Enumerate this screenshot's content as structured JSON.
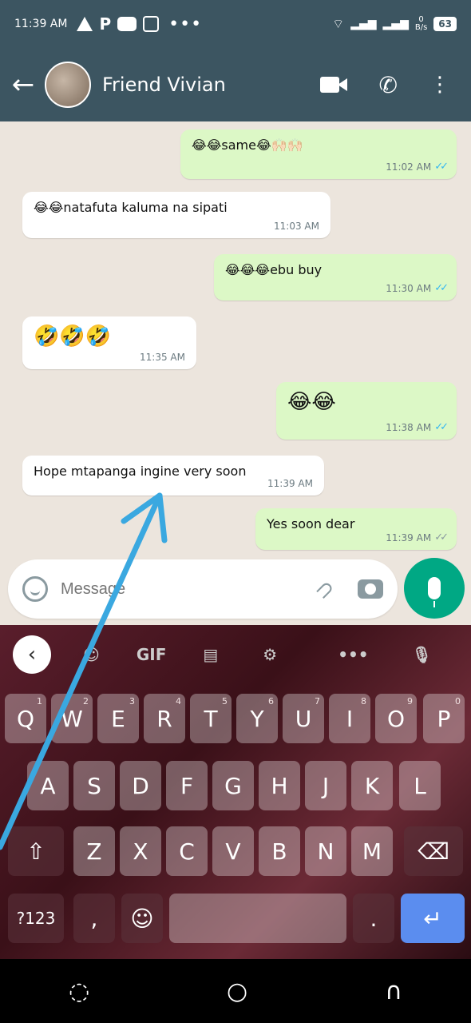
{
  "statusbar": {
    "time": "11:39 AM",
    "battery": "63",
    "speed_top": "0",
    "speed_unit": "B/s"
  },
  "header": {
    "contact_name": "Friend Vivian"
  },
  "messages": [
    {
      "dir": "out",
      "text": "😂😂same😂🙌🏻🙌🏻",
      "time": "11:02 AM",
      "status": "read"
    },
    {
      "dir": "in",
      "text": "😂😂natafuta kaluma na sipati",
      "time": "11:03 AM"
    },
    {
      "dir": "out",
      "text": "😂😂😂ebu buy",
      "time": "11:30 AM",
      "status": "read"
    },
    {
      "dir": "in",
      "text": "🤣🤣🤣",
      "time": "11:35 AM"
    },
    {
      "dir": "out",
      "text": "😂😂",
      "time": "11:38 AM",
      "status": "read"
    },
    {
      "dir": "in",
      "text": "Hope mtapanga ingine very soon",
      "time": "11:39 AM"
    },
    {
      "dir": "out",
      "text": "Yes soon dear",
      "time": "11:39 AM",
      "status": "delivered"
    }
  ],
  "input": {
    "placeholder": "Message"
  },
  "keyboard": {
    "toolbar": {
      "gif": "GIF",
      "more": "•••"
    },
    "row1": [
      {
        "k": "Q",
        "h": "1"
      },
      {
        "k": "W",
        "h": "2"
      },
      {
        "k": "E",
        "h": "3"
      },
      {
        "k": "R",
        "h": "4"
      },
      {
        "k": "T",
        "h": "5"
      },
      {
        "k": "Y",
        "h": "6"
      },
      {
        "k": "U",
        "h": "7"
      },
      {
        "k": "I",
        "h": "8"
      },
      {
        "k": "O",
        "h": "9"
      },
      {
        "k": "P",
        "h": "0"
      }
    ],
    "row2": [
      "A",
      "S",
      "D",
      "F",
      "G",
      "H",
      "J",
      "K",
      "L"
    ],
    "row3": [
      "Z",
      "X",
      "C",
      "V",
      "B",
      "N",
      "M"
    ],
    "sym": "?123",
    "comma": ",",
    "period": "."
  },
  "colors": {
    "header": "#3c5561",
    "outgoing": "#dcf8c6",
    "incoming": "#ffffff",
    "accent": "#00a884",
    "arrow": "#3aa8e0"
  }
}
